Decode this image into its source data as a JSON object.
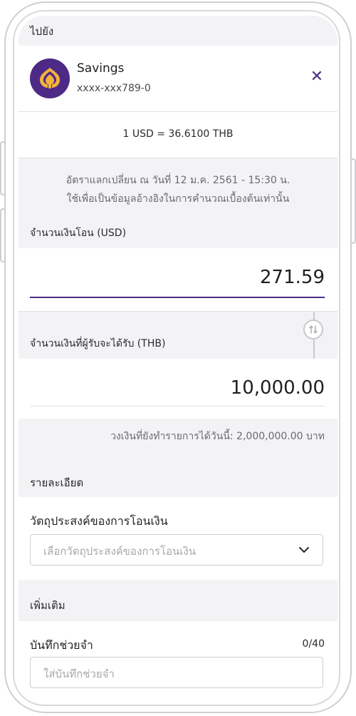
{
  "to_label": "ไปยัง",
  "account": {
    "name": "Savings",
    "number": "xxxx-xxx789-0",
    "close_symbol": "✕"
  },
  "rate": {
    "text": "1 USD = 36.6100 THB",
    "note_line1": "อัตราแลกเปลี่ยน ณ วันที่ 12 ม.ค. 2561 - 15:30 น.",
    "note_line2": "ใช้เพื่อเป็นข้อมูลอ้างอิงในการคำนวณเบื้องต้นเท่านั้น"
  },
  "send_amount": {
    "label": "จำนวนเงินโอน (USD)",
    "value": "271.59"
  },
  "receive_amount": {
    "label": "จำนวนเงินที่ผู้รับจะได้รับ (THB)",
    "value": "10,000.00"
  },
  "limit_text": "วงเงินที่ยังทำรายการได้วันนี้: 2,000,000.00 บาท",
  "details": {
    "heading": "รายละเอียด",
    "purpose_label": "วัตถุประสงค์ของการโอนเงิน",
    "purpose_placeholder": "เลือกวัตถุประสงค์ของการโอนเงิน"
  },
  "more": {
    "heading": "เพิ่มเติม",
    "memo_label": "บันทึกช่วยจำ",
    "memo_count": "0/40",
    "memo_placeholder": "ใส่บันทึกช่วยจำ"
  },
  "colors": {
    "accent": "#4d2a86",
    "logo_gold": "#f3b23a"
  },
  "icons": {
    "account_logo": "bank-logo-icon",
    "close": "close-icon",
    "swap": "swap-icon",
    "dropdown": "chevron-down-icon"
  }
}
